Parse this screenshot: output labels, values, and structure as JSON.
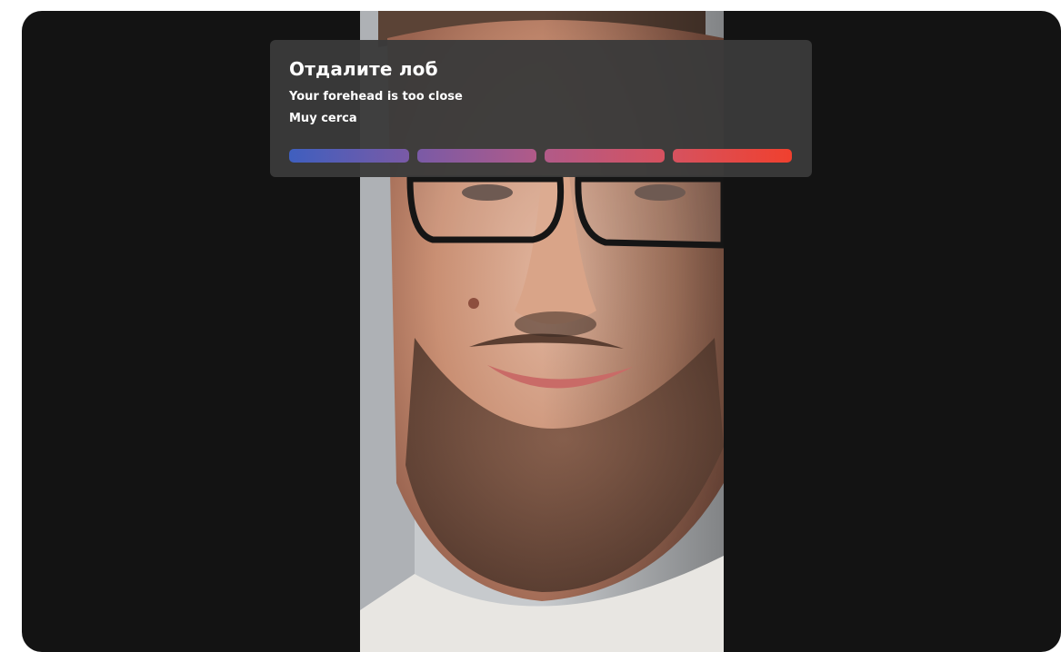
{
  "prompt": {
    "title": "Отдалите лоб",
    "line_en": "Your forehead is too close",
    "line_es": "Muy cerca"
  },
  "progress": {
    "segments": [
      {
        "from": "#3f5fbf",
        "to": "#7a5aa6"
      },
      {
        "from": "#7a5aa6",
        "to": "#b15a88"
      },
      {
        "from": "#b15a88",
        "to": "#d6525f"
      },
      {
        "from": "#d6525f",
        "to": "#f0402e"
      }
    ]
  },
  "colors": {
    "background": "#131313",
    "card": "#3a3a3a"
  },
  "camera": {
    "icon": "user-face-image"
  }
}
